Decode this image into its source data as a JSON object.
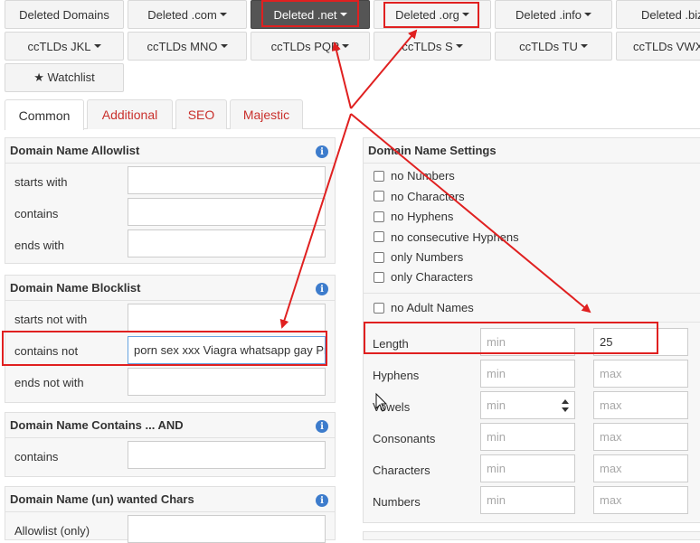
{
  "nav_row1": [
    "Deleted Domains",
    "Deleted .com",
    "Deleted .net",
    "Deleted .org",
    "Deleted .info",
    "Deleted .biz"
  ],
  "nav_row2": [
    "ccTLDs JKL",
    "ccTLDs MNO",
    "ccTLDs PQR",
    "ccTLDs S",
    "ccTLDs TU",
    "ccTLDs VWXYZ"
  ],
  "watchlist": "★ Watchlist",
  "tabs": [
    "Common",
    "Additional",
    "SEO",
    "Majestic"
  ],
  "allowlist": {
    "title": "Domain Name Allowlist",
    "rows": [
      "starts with",
      "contains",
      "ends with"
    ]
  },
  "blocklist": {
    "title": "Domain Name Blocklist",
    "rows": [
      "starts not with",
      "contains not",
      "ends not with"
    ],
    "contains_not_value": "porn sex xxx Viagra whatsapp gay Prc"
  },
  "contains_and": {
    "title": "Domain Name Contains ... AND",
    "rows": [
      "contains"
    ]
  },
  "wanted_chars": {
    "title": "Domain Name (un) wanted Chars",
    "rows": [
      "Allowlist (only)"
    ]
  },
  "settings": {
    "title": "Domain Name Settings",
    "checkboxes": [
      "no Numbers",
      "no Characters",
      "no Hyphens",
      "no consecutive Hyphens",
      "only Numbers",
      "only Characters"
    ],
    "adult": "no Adult Names",
    "ranges": [
      {
        "label": "Length",
        "min": "",
        "max": "25"
      },
      {
        "label": "Hyphens",
        "min": "",
        "max": ""
      },
      {
        "label": "Vowels",
        "min": "",
        "max": ""
      },
      {
        "label": "Consonants",
        "min": "",
        "max": ""
      },
      {
        "label": "Characters",
        "min": "",
        "max": ""
      },
      {
        "label": "Numbers",
        "min": "",
        "max": ""
      }
    ],
    "min_placeholder": "min",
    "max_placeholder": "max"
  },
  "info_glyph": "i",
  "colors": {
    "annotation": "#e02020",
    "tab_link": "#c9302c",
    "active_button": "#555555",
    "info": "#3d7ccc"
  }
}
